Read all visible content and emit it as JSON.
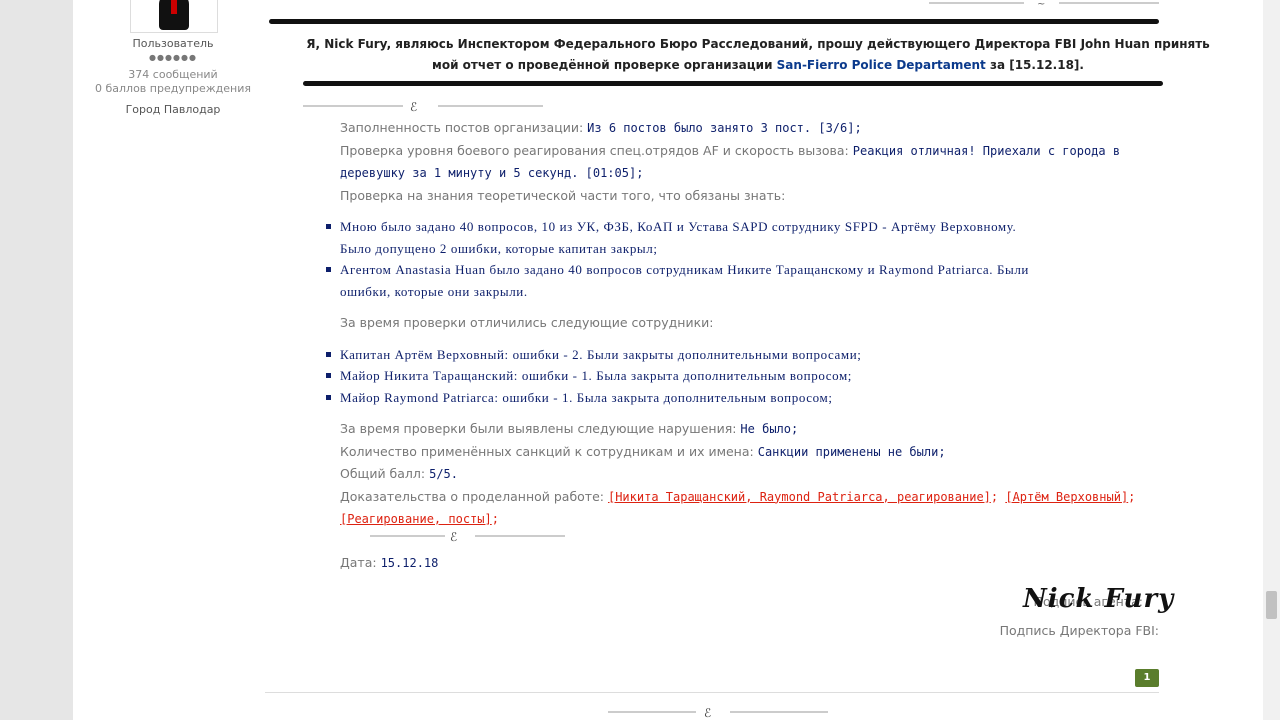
{
  "user": {
    "role": "Пользователь",
    "stars": "●●●●●●",
    "messages": "374 сообщений",
    "warnings": "0 баллов предупреждения",
    "city": "Город Павлодар"
  },
  "intro": {
    "part1": "Я, Nick Fury, являюсь Инспектором Федерального Бюро Расследований, прошу действующего Директора FBI John Huan принять мой отчет о проведённой проверке организации ",
    "org": "San-Fierro Police Departament",
    "part2": " за [15.12.18]."
  },
  "report": {
    "posts_label": "Заполненность постов организации:",
    "posts_value": "Из 6 постов было занято 3 пост. [3/6];",
    "reaction_label": "Проверка уровня боевого реагирования спец.отрядов AF и скорость вызова:",
    "reaction_value_1": "Реакция отличная! Приехали с города в",
    "reaction_value_2": "деревушку за 1 минуту и 5 секунд. [01:05];",
    "theory_label": "Проверка на знания теоретической части того, что обязаны знать:",
    "theory_items": [
      [
        "Мною было задано 40 вопросов, 10 из УК, ФЗБ, КоАП и Устава SAPD сотруднику SFPD - Артёму Верховному.",
        "Было допущено 2 ошибки, которые капитан закрыл;"
      ],
      [
        "Агентом Anastasia Huan было задано 40 вопросов сотрудникам Никите Таращанскому и Raymond Patriarca. Были",
        "ошибки, которые они закрыли."
      ]
    ],
    "distinguished_label": "За время проверки отличились следующие сотрудники:",
    "distinguished_items": [
      "Капитан Артём Верховный: ошибки - 2. Были закрыты дополнительными вопросами;",
      "Майор Никита Таращанский: ошибки - 1. Была закрыта дополнительным вопросом;",
      "Майор Raymond Patriarca: ошибки - 1. Была закрыта дополнительным вопросом;"
    ],
    "violations_label": "За время проверки были выявлены следующие нарушения:",
    "violations_value": "Не было;",
    "sanctions_label": "Количество применённых санкций к сотрудникам и их имена:",
    "sanctions_value": "Санкции применены не были;",
    "score_label": "Общий балл:",
    "score_value": "5/5.",
    "evidence_label": "Доказательства о проделанной работе:",
    "evidence_links": [
      "[Никита Таращанский, Raymond Patriarca, реагирование]",
      "[Артём Верховный]",
      "[Реагирование, посты]"
    ],
    "date_label": "Дата:",
    "date_value": "15.12.18"
  },
  "signature": {
    "agent_label": "Подпись агента:",
    "agent_signature": "Nick Fury",
    "director_label": "Подпись Директора FBI:"
  },
  "reactions": {
    "like_count": "1"
  }
}
